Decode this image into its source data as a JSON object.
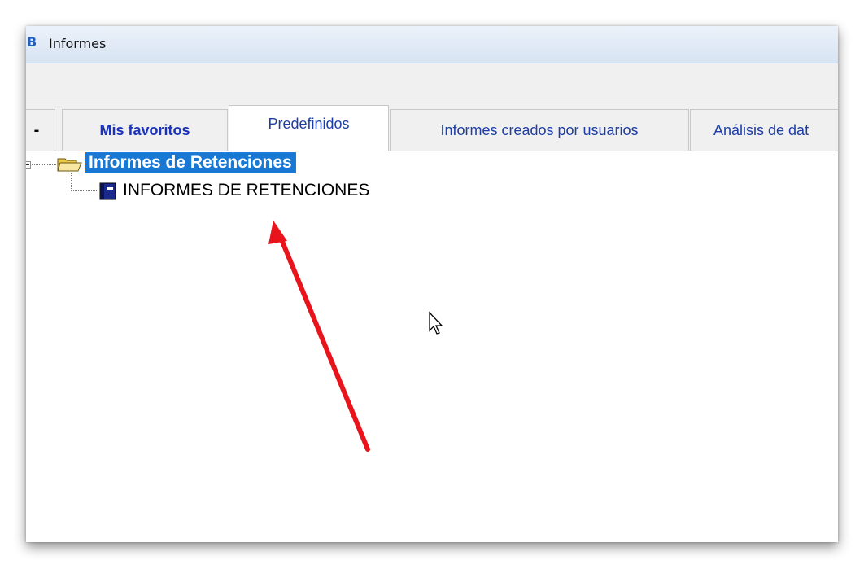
{
  "window": {
    "title": "Informes",
    "app_icon_text": "B"
  },
  "tabs": [
    {
      "label": "-",
      "active": false
    },
    {
      "label": "Mis favoritos",
      "active": false
    },
    {
      "label": "Predefinidos",
      "active": true
    },
    {
      "label": "Informes creados por usuarios",
      "active": false
    },
    {
      "label": "Análisis de dat",
      "active": false
    }
  ],
  "tree": {
    "root": {
      "label": "Informes de Retenciones",
      "icon": "folder-open-icon",
      "selected": true,
      "expanded": true
    },
    "child": {
      "label": "INFORMES DE RETENCIONES",
      "icon": "report-book-icon"
    }
  },
  "colors": {
    "selection": "#1978d4",
    "tab_text": "#1d3fa3",
    "annotation_arrow": "#e8131b"
  }
}
